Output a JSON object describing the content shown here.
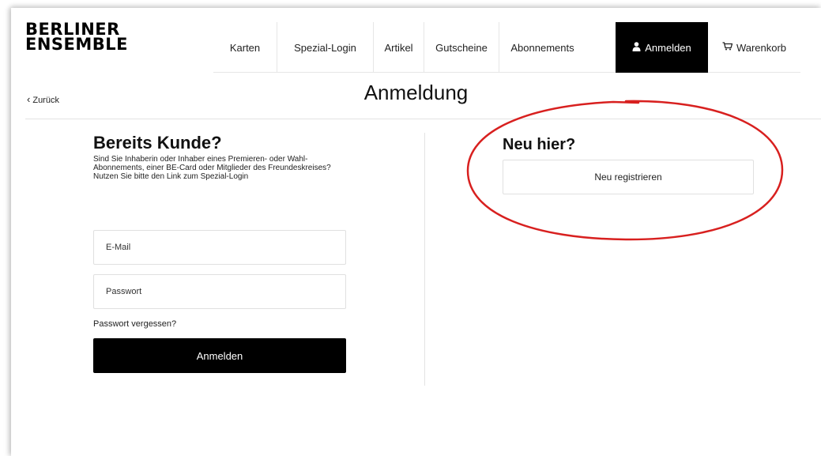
{
  "brand": {
    "line1": "BERLINER",
    "line2": "ENSEMBLE"
  },
  "nav": {
    "items": [
      {
        "label": "Karten"
      },
      {
        "label": "Spezial-Login"
      },
      {
        "label": "Artikel"
      },
      {
        "label": "Gutscheine"
      },
      {
        "label": "Abonnements"
      }
    ],
    "login_label": "Anmelden",
    "login_icon": "user-icon",
    "cart_label": "Warenkorb",
    "cart_icon": "cart-icon"
  },
  "back_label": "Zurück",
  "page_title": "Anmeldung",
  "existing": {
    "title": "Bereits Kunde?",
    "description": "Sind Sie Inhaberin oder Inhaber eines Premieren- oder Wahl-Abonnements, einer BE-Card oder Mitglieder des Freundeskreises? Nutzen Sie bitte den Link zum Spezial-Login",
    "email_placeholder": "E-Mail",
    "password_placeholder": "Passwort",
    "forgot_label": "Passwort vergessen?",
    "submit_label": "Anmelden"
  },
  "new_customer": {
    "title": "Neu hier?",
    "register_label": "Neu registrieren"
  },
  "colors": {
    "primary": "#000000",
    "annotation": "#d8201f",
    "border": "#e0e0e0"
  }
}
